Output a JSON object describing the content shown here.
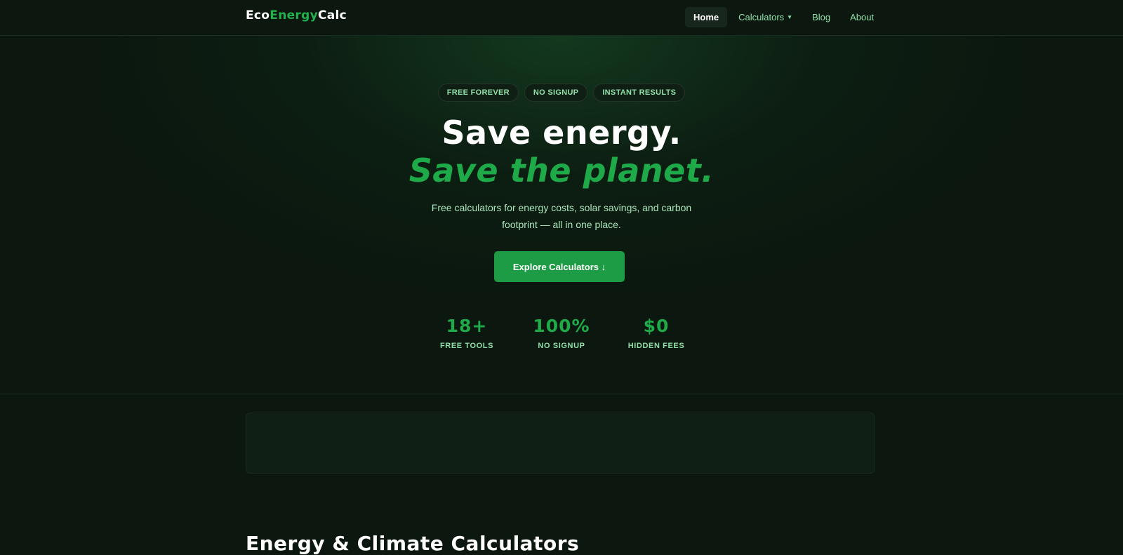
{
  "nav": {
    "logo": {
      "part1": "Eco",
      "part2": "Energy",
      "part3": "Calc"
    },
    "links": [
      {
        "label": "Home",
        "active": true
      },
      {
        "label": "Calculators",
        "dropdown_icon": "caret-down-icon"
      },
      {
        "label": "Blog"
      },
      {
        "label": "About"
      }
    ]
  },
  "hero": {
    "badges": [
      "FREE FOREVER",
      "NO SIGNUP",
      "INSTANT RESULTS"
    ],
    "headline_line1": "Save energy.",
    "headline_line2": "Save the planet.",
    "subtitle": "Free calculators for energy costs, solar savings, and carbon footprint — all in one place.",
    "cta_label": "Explore Calculators ↓",
    "stats": [
      {
        "value": "18+",
        "label": "FREE TOOLS"
      },
      {
        "value": "100%",
        "label": "NO SIGNUP"
      },
      {
        "value": "$0",
        "label": "HIDDEN FEES"
      }
    ]
  },
  "section": {
    "title": "Energy & Climate Calculators"
  },
  "colors": {
    "background": "#0b170f",
    "accent": "#1faa49",
    "button": "#1e9c45",
    "muted_text": "#8fe0a8"
  }
}
